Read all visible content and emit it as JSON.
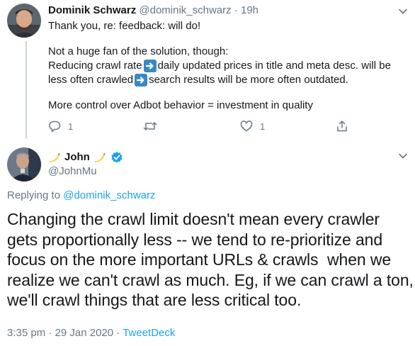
{
  "reply_tweet": {
    "author_name": "Dominik Schwarz",
    "author_handle": "@dominik_schwarz",
    "separator": "·",
    "time_ago": "19h",
    "lines": {
      "l1": "Thank you, re: feedback: will do!",
      "l2": "Not a huge fan of the solution, though:",
      "l3a": "Reducing crawl rate",
      "l3b": " daily updated prices in title and meta desc. will be",
      "l4a": "less often crawled",
      "l4b": " search results will be more often outdated.",
      "l5": "More control over Adbot behavior = investment in quality"
    },
    "reply_count": "1",
    "retweet_count": "",
    "like_count": "1"
  },
  "main_tweet": {
    "author_name": "John",
    "author_handle": "@JohnMu",
    "replying_to_label": "Replying to",
    "replying_to_handle": "@dominik_schwarz",
    "text_lines": {
      "l1": "Changing the crawl limit doesn't mean every crawler",
      "l2": "gets proportionally less -- we tend to re-prioritize and",
      "l3": "focus on the more important URLs & crawls  when we",
      "l4": "realize we can't crawl as much. Eg, if we can crawl a ton,",
      "l5": "we'll crawl things that are less critical too."
    },
    "time": "3:35 pm",
    "date": "29 Jan 2020",
    "dot": "·",
    "source": "TweetDeck"
  },
  "colors": {
    "text": "#14171a",
    "muted": "#657786",
    "link": "#1da1f2",
    "thread_line": "#ccd6dd",
    "emoji_arrow_bg": "#3b88c3",
    "verified": "#1da1f2"
  },
  "icons": {
    "reply": "reply-icon",
    "retweet": "retweet-icon",
    "like": "heart-icon",
    "share": "share-icon",
    "caret": "chevron-down-icon",
    "verified": "verified-badge-icon",
    "banana": "banana-emoji-icon",
    "arrow": "right-arrow-emoji-icon"
  }
}
